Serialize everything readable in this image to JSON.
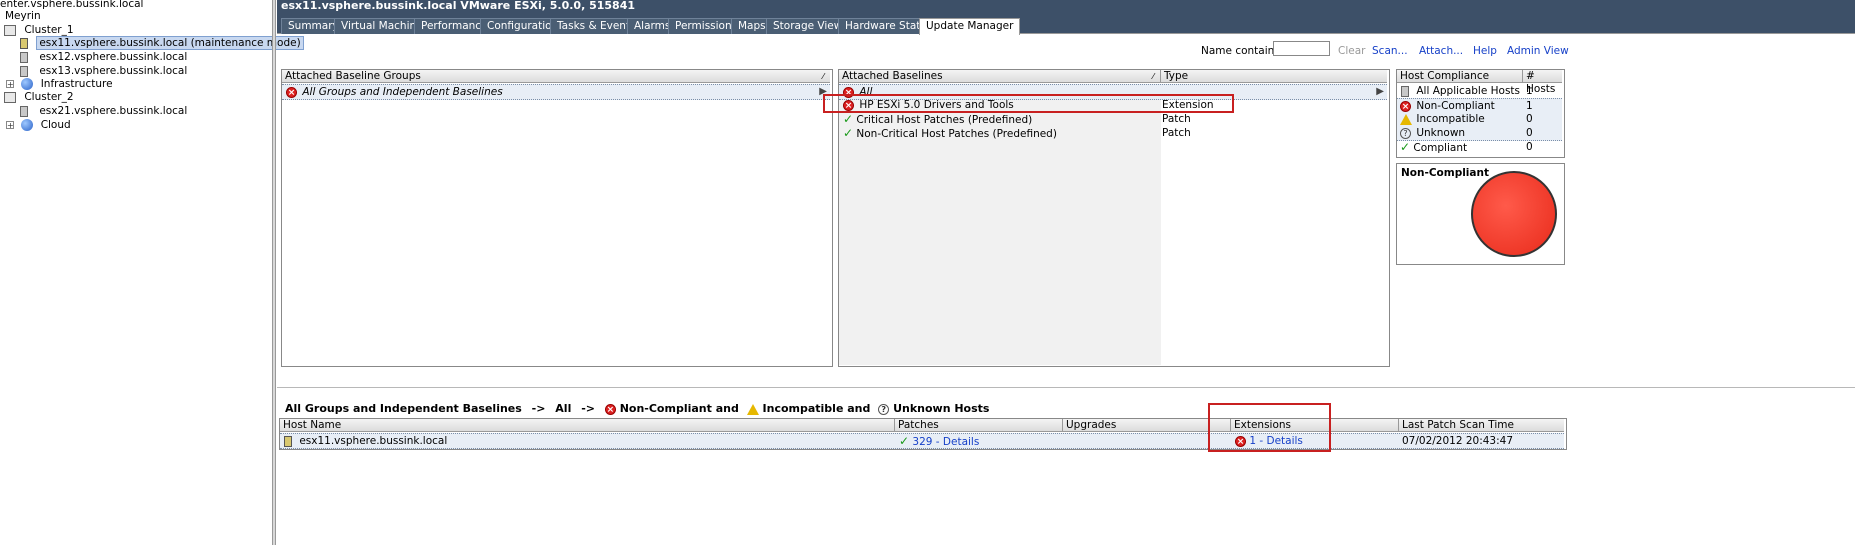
{
  "tree": {
    "vcenter": "enter.vsphere.bussink.local",
    "datacenter": "Meyrin",
    "cluster1": "Cluster_1",
    "hosts1": [
      "esx11.vsphere.bussink.local (maintenance mode)",
      "esx12.vsphere.bussink.local",
      "esx13.vsphere.bussink.local"
    ],
    "infra": "Infrastructure",
    "cluster2": "Cluster_2",
    "hosts2": [
      "esx21.vsphere.bussink.local"
    ],
    "cloud": "Cloud"
  },
  "header": {
    "title": "esx11.vsphere.bussink.local VMware ESXi, 5.0.0, 515841"
  },
  "tabs": [
    "Summary",
    "Virtual Machines",
    "Performance",
    "Configuration",
    "Tasks & Events",
    "Alarms",
    "Permissions",
    "Maps",
    "Storage Views",
    "Hardware Status",
    "Update Manager"
  ],
  "toolbar": {
    "name_contains": "Name contains:",
    "clear": "Clear",
    "scan": "Scan...",
    "attach": "Attach...",
    "help": "Help",
    "admin": "Admin View"
  },
  "groups": {
    "header": "Attached Baseline Groups",
    "row": "All Groups and Independent Baselines"
  },
  "baselines": {
    "header_name": "Attached Baselines",
    "header_type": "Type",
    "all": "All",
    "rows": [
      {
        "name": "HP ESXi 5.0 Drivers and Tools",
        "type": "Extension",
        "status": "error"
      },
      {
        "name": "Critical Host Patches (Predefined)",
        "type": "Patch",
        "status": "ok"
      },
      {
        "name": "Non-Critical Host Patches (Predefined)",
        "type": "Patch",
        "status": "ok"
      }
    ]
  },
  "compliance": {
    "header_name": "Host Compliance",
    "header_count": "# Hosts",
    "rows": [
      {
        "label": "All Applicable Hosts",
        "count": "1"
      },
      {
        "label": "Non-Compliant",
        "count": "1"
      },
      {
        "label": "Incompatible",
        "count": "0"
      },
      {
        "label": "Unknown",
        "count": "0"
      },
      {
        "label": "Compliant",
        "count": "0"
      }
    ],
    "chart_title": "Non-Compliant",
    "chart_color": "#ff3a2a"
  },
  "filter_bar": {
    "group": "All Groups and Independent Baselines",
    "arrow": "->",
    "all": "All",
    "noncompliant": "Non-Compliant and",
    "incompatible": "Incompatible and",
    "unknown": "Unknown Hosts"
  },
  "hosts_table": {
    "headers": [
      "Host Name",
      "Patches",
      "Upgrades",
      "Extensions",
      "Last Patch Scan Time"
    ],
    "row": {
      "host": "esx11.vsphere.bussink.local",
      "patches": "329 - Details",
      "upgrades": "",
      "extensions": "1 - Details",
      "scan_time": "07/02/2012 20:43:47"
    }
  }
}
